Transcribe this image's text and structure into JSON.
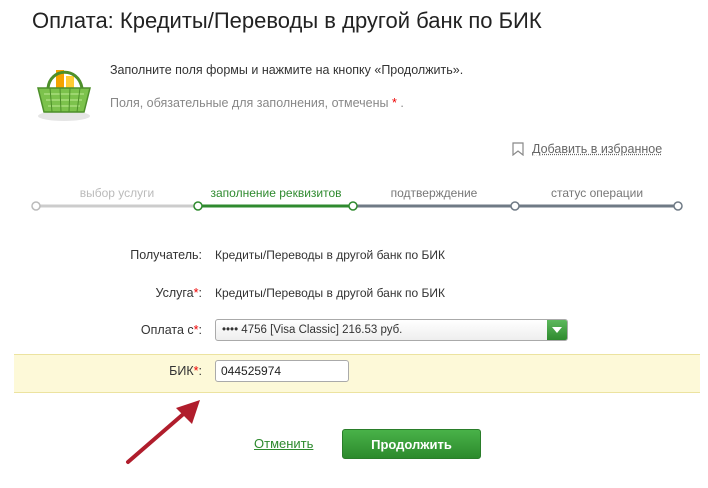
{
  "page": {
    "title": "Оплата: Кредиты/Переводы в другой банк по БИК",
    "instruction": "Заполните поля формы и нажмите на кнопку «Продолжить».",
    "required_note": "Поля, обязательные для заполнения, отмечены",
    "required_star": "*",
    "required_end": "."
  },
  "favorites": {
    "label": "Добавить в избранное"
  },
  "steps": [
    {
      "label": "выбор услуги",
      "state": "past"
    },
    {
      "label": "заполнение реквизитов",
      "state": "current"
    },
    {
      "label": "подтверждение",
      "state": "future"
    },
    {
      "label": "статус операции",
      "state": "future"
    }
  ],
  "form": {
    "recipient": {
      "label": "Получатель:",
      "value": "Кредиты/Переводы в другой банк по БИК"
    },
    "service": {
      "label": "Услуга",
      "star": "*",
      "colon": ":",
      "value": "Кредиты/Переводы в другой банк по БИК"
    },
    "payment_from": {
      "label": "Оплата с",
      "star": "*",
      "colon": ":",
      "selected": "•••• 4756 [Visa Classic] 216.53 руб."
    },
    "bik": {
      "label": "БИК",
      "star": "*",
      "colon": ":",
      "value": "044525974"
    }
  },
  "actions": {
    "cancel": "Отменить",
    "continue": "Продолжить"
  },
  "colors": {
    "accent_green": "#2e8a2e",
    "highlight": "#fdf9d8",
    "arrow_red": "#b01d2c",
    "required_red": "#e00000"
  }
}
